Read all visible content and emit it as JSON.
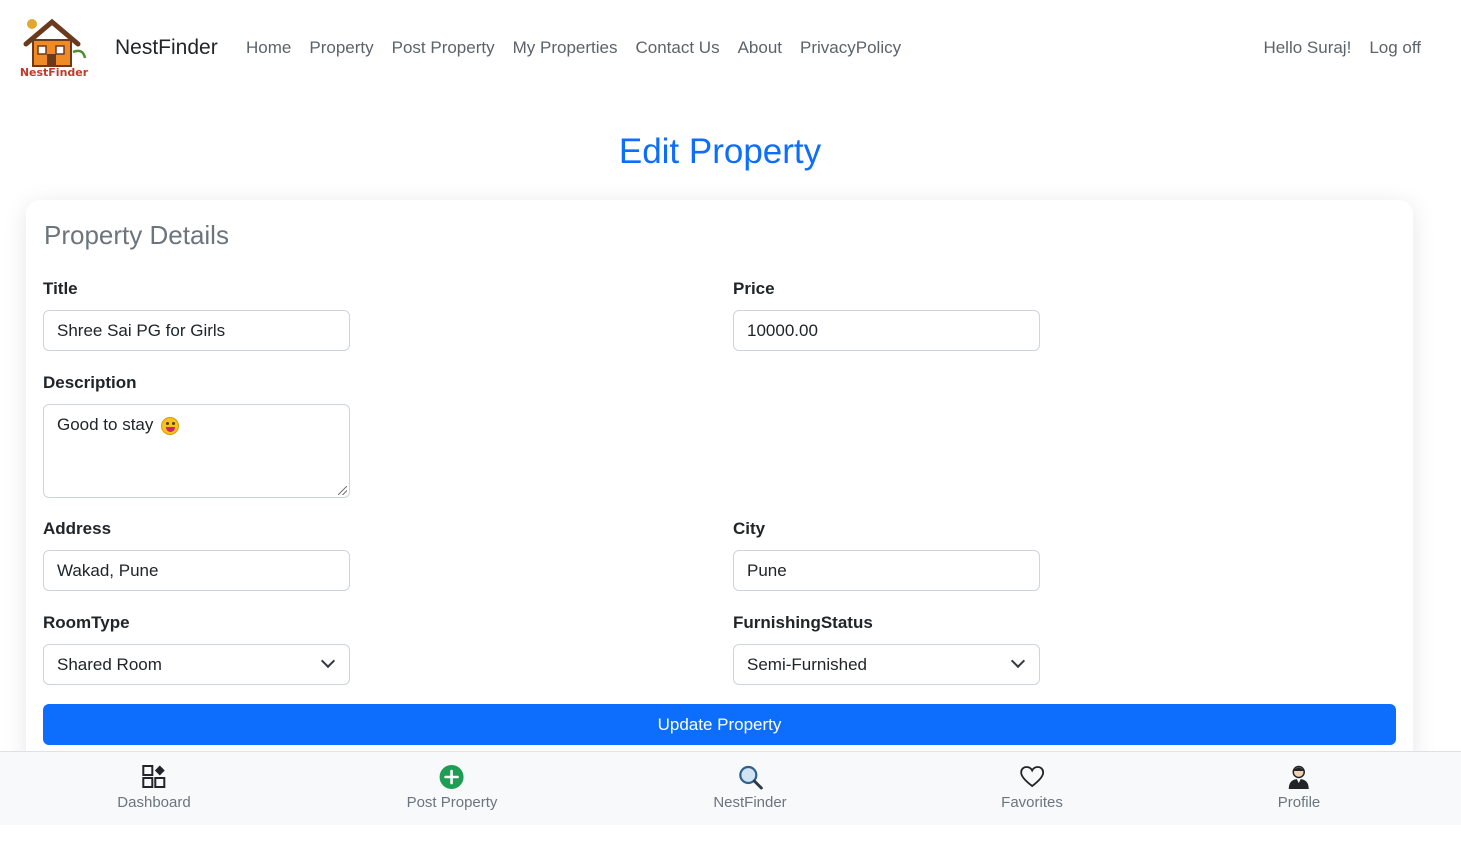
{
  "navbar": {
    "brand": "NestFinder",
    "logo_text": "NestFinder",
    "links": [
      "Home",
      "Property",
      "Post Property",
      "My Properties",
      "Contact Us",
      "About",
      "PrivacyPolicy"
    ],
    "greeting": "Hello Suraj!",
    "logout": "Log off"
  },
  "page": {
    "title": "Edit Property"
  },
  "form": {
    "section_title": "Property Details",
    "title_label": "Title",
    "title_value": "Shree Sai PG for Girls",
    "price_label": "Price",
    "price_value": "10000.00",
    "description_label": "Description",
    "description_value": "Good to stay",
    "address_label": "Address",
    "address_value": "Wakad, Pune",
    "city_label": "City",
    "city_value": "Pune",
    "roomtype_label": "RoomType",
    "roomtype_value": "Shared Room",
    "furnishing_label": "FurnishingStatus",
    "furnishing_value": "Semi-Furnished",
    "submit_label": "Update Property"
  },
  "bottom_nav": {
    "items": [
      {
        "label": "Dashboard",
        "icon": "dashboard-icon"
      },
      {
        "label": "Post Property",
        "icon": "plus-circle-icon"
      },
      {
        "label": "NestFinder",
        "icon": "search-icon"
      },
      {
        "label": "Favorites",
        "icon": "heart-icon"
      },
      {
        "label": "Profile",
        "icon": "user-icon"
      }
    ]
  },
  "colors": {
    "primary": "#0d6efd",
    "post_green": "#1f9d55"
  }
}
